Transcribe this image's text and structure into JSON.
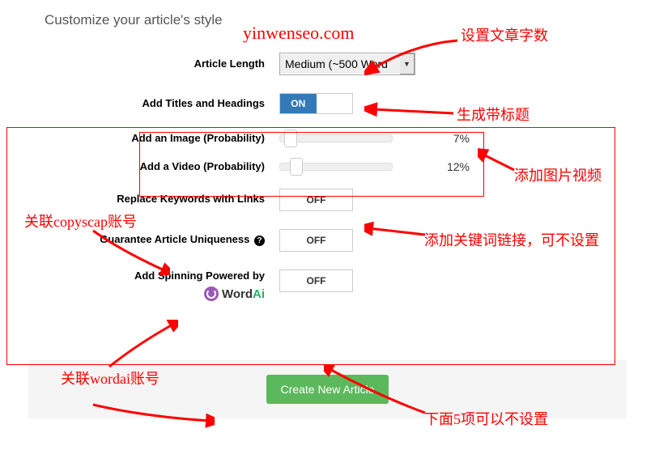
{
  "section_title": "Customize your article's style",
  "form": {
    "article_length": {
      "label": "Article Length",
      "value": "Medium (~500 Word"
    },
    "titles_headings": {
      "label": "Add Titles and Headings",
      "state": "ON"
    },
    "add_image": {
      "label": "Add an Image (Probability)",
      "value": 7,
      "display": "7%"
    },
    "add_video": {
      "label": "Add a Video (Probability)",
      "value": 12,
      "display": "12%"
    },
    "replace_keywords": {
      "label": "Replace Keywords with Links",
      "state": "OFF"
    },
    "guarantee_unique": {
      "label": "Guarantee Article Uniqueness",
      "state": "OFF"
    },
    "add_spinning": {
      "label": "Add Spinning Powered by",
      "state": "OFF",
      "brand_a": "Word",
      "brand_b": "Ai"
    }
  },
  "submit_label": "Create New Article",
  "annotations": {
    "watermark": "yinwenseo.com",
    "a1": "设置文章字数",
    "a2": "生成带标题",
    "a3": "添加图片视频",
    "a4": "添加关键词链接，可不设置",
    "a5": "关联copyscap账号",
    "a6": "关联wordai账号",
    "a7": "下面5项可以不设置"
  }
}
